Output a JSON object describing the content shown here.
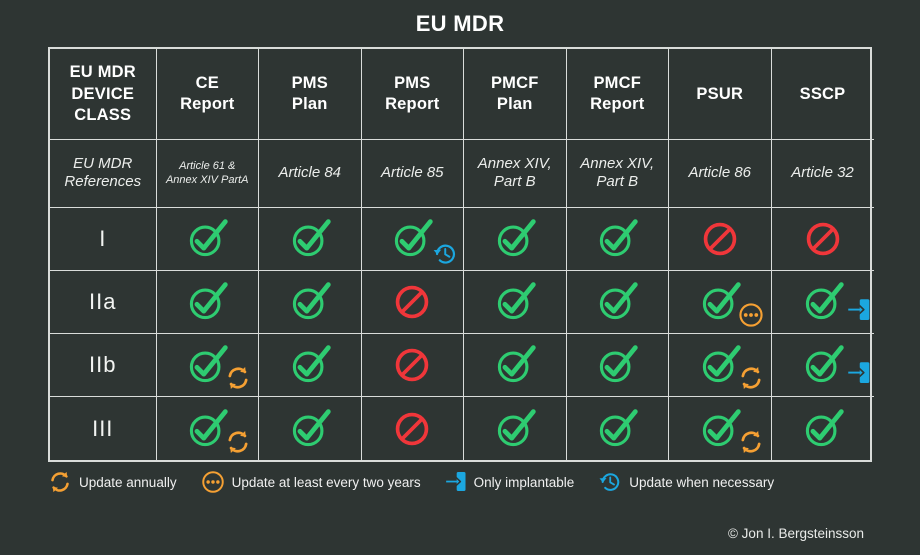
{
  "title": "EU MDR",
  "colors": {
    "background": "#2e3533",
    "grid": "#d9dcda",
    "check_green": "#2ecc71",
    "deny_red": "#f0363a",
    "orange": "#f5a033",
    "blue": "#1ba7e0",
    "text": "#f1f1f1"
  },
  "table": {
    "headers": [
      "EU MDR DEVICE CLASS",
      "CE Report",
      "PMS Plan",
      "PMS Report",
      "PMCF Plan",
      "PMCF Report",
      "PSUR",
      "SSCP"
    ],
    "references_label": "EU MDR References",
    "references": [
      "Article 61 & Annex XIV PartA",
      "Article 84",
      "Article 85",
      "Annex XIV, Part B",
      "Annex XIV, Part B",
      "Article 86",
      "Article 32"
    ],
    "rows": [
      {
        "class": "I",
        "cells": [
          {
            "status": "yes",
            "badge": null
          },
          {
            "status": "yes",
            "badge": null
          },
          {
            "status": "yes",
            "badge": "clock"
          },
          {
            "status": "yes",
            "badge": null
          },
          {
            "status": "yes",
            "badge": null
          },
          {
            "status": "no",
            "badge": null
          },
          {
            "status": "no",
            "badge": null
          }
        ]
      },
      {
        "class": "IIa",
        "cells": [
          {
            "status": "yes",
            "badge": null
          },
          {
            "status": "yes",
            "badge": null
          },
          {
            "status": "no",
            "badge": null
          },
          {
            "status": "yes",
            "badge": null
          },
          {
            "status": "yes",
            "badge": null
          },
          {
            "status": "yes",
            "badge": "dots"
          },
          {
            "status": "yes",
            "badge": "implant"
          }
        ]
      },
      {
        "class": "IIb",
        "cells": [
          {
            "status": "yes",
            "badge": "sync"
          },
          {
            "status": "yes",
            "badge": null
          },
          {
            "status": "no",
            "badge": null
          },
          {
            "status": "yes",
            "badge": null
          },
          {
            "status": "yes",
            "badge": null
          },
          {
            "status": "yes",
            "badge": "sync"
          },
          {
            "status": "yes",
            "badge": "implant"
          }
        ]
      },
      {
        "class": "III",
        "cells": [
          {
            "status": "yes",
            "badge": "sync"
          },
          {
            "status": "yes",
            "badge": null
          },
          {
            "status": "no",
            "badge": null
          },
          {
            "status": "yes",
            "badge": null
          },
          {
            "status": "yes",
            "badge": null
          },
          {
            "status": "yes",
            "badge": "sync"
          },
          {
            "status": "yes",
            "badge": null
          }
        ]
      }
    ]
  },
  "legend": [
    {
      "icon": "sync-icon",
      "label": "Update annually"
    },
    {
      "icon": "dots-icon",
      "label": "Update at least every two years"
    },
    {
      "icon": "implant-icon",
      "label": "Only implantable"
    },
    {
      "icon": "clock-icon",
      "label": "Update when necessary"
    }
  ],
  "credit": "© Jon I. Bergsteinsson"
}
